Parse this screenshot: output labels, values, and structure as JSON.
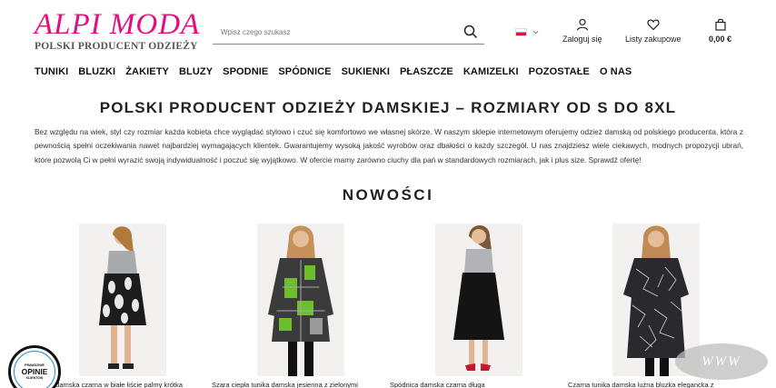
{
  "header": {
    "logo_main": "ALPI MODA",
    "logo_sub": "POLSKI PRODUCENT ODZIEŻY",
    "search_placeholder": "Wpisz czego szukasz",
    "login_label": "Zaloguj się",
    "wishlist_label": "Listy zakupowe",
    "cart_total": "0,00 €"
  },
  "nav": {
    "items": [
      "TUNIKI",
      "BLUZKI",
      "ŻAKIETY",
      "BLUZY",
      "SPODNIE",
      "SPÓDNICE",
      "SUKIENKI",
      "PŁASZCZE",
      "KAMIZELKI",
      "POZOSTAŁE",
      "O NAS"
    ]
  },
  "hero": {
    "title": "POLSKI PRODUCENT ODZIEŻY DAMSKIEJ – ROZMIARY OD S DO 8XL",
    "text": "Bez względu na wiek, styl czy rozmiar każda kobieta chce wyglądać stylowo i czuć się komfortowo we własnej skórze. W naszym sklepie internetowym oferujemy odzież damską od polskiego producenta, która z pewnością spełni oczekiwania nawet najbardziej wymagających klientek. Gwarantujemy wysoką jakość wyrobów oraz dbałości o każdy szczegół. U nas znajdziesz wiele ciekawych, modnych propozycji ubrań, które pozwolą Ci w pełni wyrazić swoją indywidualność i poczuć się wyjątkowo. W ofercie mamy zarówno ciuchy dla pań w standardowych rozmiarach, jak i plus size. Sprawdź ofertę!"
  },
  "section": {
    "title": "NOWOŚCI"
  },
  "products": [
    {
      "name": "a damska czarna w białe liście palmy krótka"
    },
    {
      "name": "Szara ciepła tunika damska jesienna z zielonymi"
    },
    {
      "name": "Spódnica damska czarna długa"
    },
    {
      "name": "Czarna tunika damska luźna bluzka elegancka z"
    }
  ],
  "badge": {
    "top": "PRAWDZIWE",
    "main": "OPINIE",
    "bottom": "KLIENTÓW"
  },
  "watermark": "WWW",
  "colors": {
    "brand": "#e0107c",
    "accent_green": "#6cbf2b"
  }
}
